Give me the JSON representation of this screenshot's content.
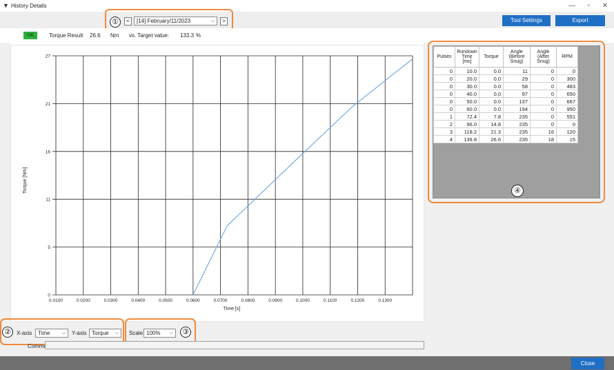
{
  "window": {
    "title": "History Details",
    "controls": [
      "—",
      "▫",
      "✕"
    ]
  },
  "navigator": {
    "callout": "①",
    "prev_label": "<",
    "next_label": ">",
    "selected": "[14] February/11/2023"
  },
  "toolbar": {
    "tool_settings_label": "Tool Settings",
    "export_label": "Export"
  },
  "result": {
    "status": "OK",
    "status_color": "#2fae3e",
    "torque_label": "Torque Result",
    "torque_value": "26.6",
    "unit": "Nm",
    "target_label": "vs. Target value:",
    "target_value": "133.3",
    "target_unit": "%"
  },
  "chart_data": {
    "type": "line",
    "xlabel": "Time [s]",
    "ylabel": "Torque [Nm]",
    "xlim": [
      0.01,
      0.14
    ],
    "ylim": [
      0,
      27
    ],
    "xticks": [
      "0.0100",
      "0.0200",
      "0.0300",
      "0.0400",
      "0.0500",
      "0.0600",
      "0.0700",
      "0.0800",
      "0.0900",
      "0.1000",
      "0.1100",
      "0.1200",
      "0.1300"
    ],
    "yticks": [
      "0",
      "5",
      "11",
      "16",
      "21",
      "27"
    ],
    "ytick_values": [
      0,
      5.4,
      10.8,
      16.2,
      21.6,
      27
    ],
    "grid": true,
    "line_color": "#6aa6e0",
    "x": [
      0.06,
      0.0724,
      0.096,
      0.1182,
      0.1398
    ],
    "y": [
      0.0,
      7.8,
      14.8,
      21.3,
      26.6
    ]
  },
  "table": {
    "headers": [
      [
        "Pulses"
      ],
      [
        "Rundown",
        "Time",
        "[ms]"
      ],
      [
        "Torque"
      ],
      [
        "Angle",
        "(Before",
        "Snug)"
      ],
      [
        "Angle",
        "(After",
        "Snug)"
      ],
      [
        "RPM"
      ]
    ],
    "rows": [
      [
        "0",
        "10.0",
        "0.0",
        "11",
        "0",
        "0"
      ],
      [
        "0",
        "20.0",
        "0.0",
        "29",
        "0",
        "300"
      ],
      [
        "0",
        "30.0",
        "0.0",
        "58",
        "0",
        "483"
      ],
      [
        "0",
        "40.0",
        "0.0",
        "97",
        "0",
        "650"
      ],
      [
        "0",
        "50.0",
        "0.0",
        "137",
        "0",
        "667"
      ],
      [
        "0",
        "60.0",
        "0.0",
        "194",
        "0",
        "950"
      ],
      [
        "1",
        "72.4",
        "7.8",
        "235",
        "0",
        "551"
      ],
      [
        "2",
        "96.0",
        "14.8",
        "235",
        "0",
        "0"
      ],
      [
        "3",
        "118.2",
        "21.3",
        "235",
        "16",
        "120"
      ],
      [
        "4",
        "139.8",
        "26.6",
        "235",
        "18",
        "15"
      ]
    ],
    "callout": "④"
  },
  "axes_controls": {
    "callout": "②",
    "xaxis_label": "X-axis",
    "xaxis_value": "Time",
    "yaxis_label": "Y-axis",
    "yaxis_value": "Torque"
  },
  "scale_control": {
    "callout": "③",
    "label": "Scale",
    "value": "100%"
  },
  "comment": {
    "label": "Comment",
    "value": ""
  },
  "footer": {
    "close_label": "Close"
  },
  "colors": {
    "accent_button": "#1f6fc5",
    "callout_border": "#f08a3c"
  }
}
